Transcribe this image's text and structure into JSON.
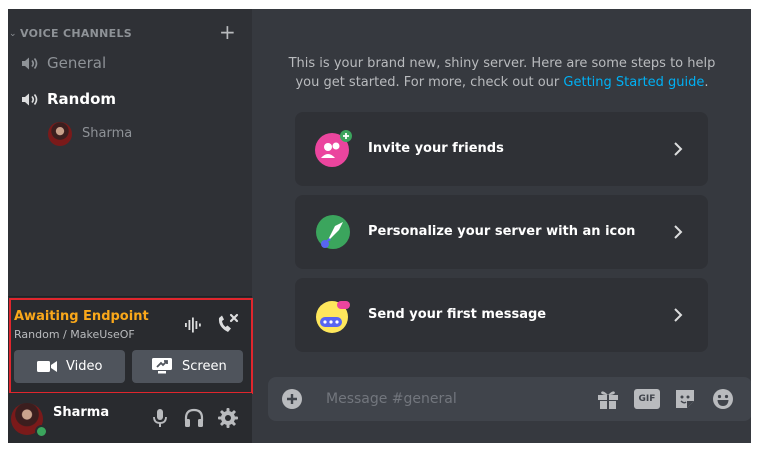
{
  "sidebar": {
    "category_title": "VOICE CHANNELS",
    "channels": [
      {
        "name": "General",
        "active": false
      },
      {
        "name": "Random",
        "active": true
      }
    ],
    "voice_users": [
      {
        "name": "Sharma"
      }
    ]
  },
  "voice_panel": {
    "status": "Awaiting Endpoint",
    "location": "Random / MakeUseOF",
    "video_label": "Video",
    "screen_label": "Screen",
    "status_color": "#faa81a"
  },
  "user_bar": {
    "username": "Sharma",
    "status": "online"
  },
  "main": {
    "intro_text": "This is your brand new, shiny server. Here are some steps to help you get started. For more, check out our ",
    "intro_link": "Getting Started guide",
    "intro_end": ".",
    "cards": [
      {
        "label": "Invite your friends",
        "icon": "invite-friends-icon"
      },
      {
        "label": "Personalize your server with an icon",
        "icon": "paintbrush-icon"
      },
      {
        "label": "Send your first message",
        "icon": "message-bubble-icon"
      }
    ]
  },
  "composer": {
    "placeholder": "Message #general",
    "gif_label": "GIF"
  },
  "colors": {
    "sidebar_bg": "#2f3136",
    "main_bg": "#36393f",
    "accent_link": "#00b0f4",
    "highlight_box": "#e0262d"
  }
}
